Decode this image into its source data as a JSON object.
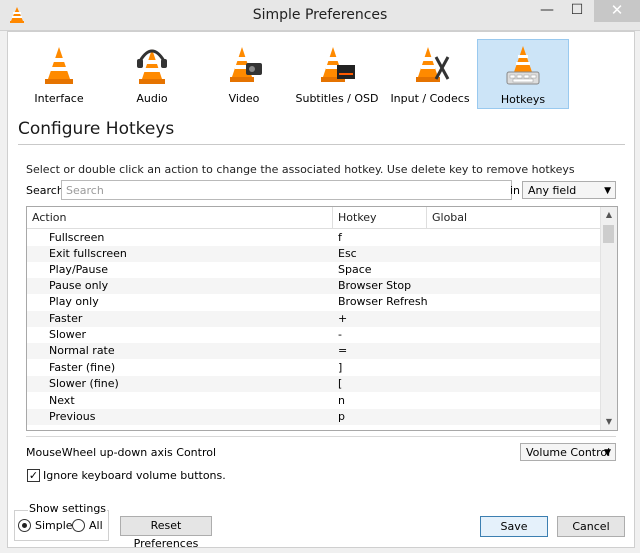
{
  "window": {
    "title": "Simple Preferences",
    "controls": {
      "minimize": "—",
      "maximize": "☐",
      "close": "✕"
    }
  },
  "categories": [
    {
      "label": "Interface",
      "icon": "interface-cone-icon",
      "active": false
    },
    {
      "label": "Audio",
      "icon": "audio-headphones-cone-icon",
      "active": false
    },
    {
      "label": "Video",
      "icon": "video-cone-icon",
      "active": false
    },
    {
      "label": "Subtitles / OSD",
      "icon": "subtitles-cone-icon",
      "active": false
    },
    {
      "label": "Input / Codecs",
      "icon": "input-codecs-cone-icon",
      "active": false
    },
    {
      "label": "Hotkeys",
      "icon": "hotkeys-cone-icon",
      "active": true
    }
  ],
  "section_title": "Configure Hotkeys",
  "instructions": "Select or double click an action to change the associated hotkey. Use delete key to remove hotkeys",
  "search": {
    "label": "Search",
    "placeholder": "Search",
    "value": "",
    "in_label": "in",
    "field": "Any field"
  },
  "table": {
    "headers": [
      "Action",
      "Hotkey",
      "Global"
    ],
    "rows": [
      {
        "action": "Fullscreen",
        "hotkey": "f",
        "global": ""
      },
      {
        "action": "Exit fullscreen",
        "hotkey": "Esc",
        "global": ""
      },
      {
        "action": "Play/Pause",
        "hotkey": "Space",
        "global": ""
      },
      {
        "action": "Pause only",
        "hotkey": "Browser Stop",
        "global": ""
      },
      {
        "action": "Play only",
        "hotkey": "Browser Refresh",
        "global": ""
      },
      {
        "action": "Faster",
        "hotkey": "+",
        "global": ""
      },
      {
        "action": "Slower",
        "hotkey": "-",
        "global": ""
      },
      {
        "action": "Normal rate",
        "hotkey": "=",
        "global": ""
      },
      {
        "action": "Faster (fine)",
        "hotkey": "]",
        "global": ""
      },
      {
        "action": "Slower (fine)",
        "hotkey": "[",
        "global": ""
      },
      {
        "action": "Next",
        "hotkey": "n",
        "global": ""
      },
      {
        "action": "Previous",
        "hotkey": "p",
        "global": ""
      }
    ]
  },
  "mousewheel": {
    "label": "MouseWheel up-down axis Control",
    "value": "Volume Control"
  },
  "ignore_volume": {
    "label": "Ignore keyboard volume buttons.",
    "checked": true
  },
  "show_settings": {
    "label": "Show settings",
    "simple": "Simple",
    "all": "All",
    "selected": "Simple"
  },
  "buttons": {
    "reset": "Reset Preferences",
    "save": "Save",
    "cancel": "Cancel"
  }
}
